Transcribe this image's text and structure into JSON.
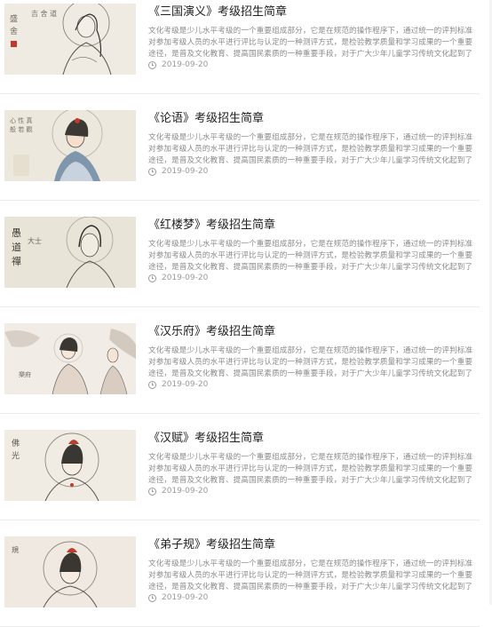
{
  "articles": [
    {
      "title": "《三国演义》考级招生简章",
      "excerpt": "文化考级是少儿水平考级的一个重要组成部分，它是在规范的操作程序下，通过统一的评判标准对参加考级人员的水平进行评比与认定的一种测评方式，是检验教学质量和学习成果的一个重要途径，是普及文化教育、提高国民素质的一种重要手段，对于广大少年儿童学习传统文化起到了积极的推动作用。",
      "date": "2019-09-20",
      "image_icon": "guanyin-painting-thumbnail"
    },
    {
      "title": "《论语》考级招生简章",
      "excerpt": "文化考级是少儿水平考级的一个重要组成部分，它是在规范的操作程序下，通过统一的评判标准对参加考级人员的水平进行评比与认定的一种测评方式，是检验教学质量和学习成果的一个重要途径，是普及文化教育、提高国民素质的一种重要手段，对于广大少年儿童学习传统文化起到了积极的推动作用。",
      "date": "2019-09-20",
      "image_icon": "guanyin-painting-thumbnail"
    },
    {
      "title": "《红楼梦》考级招生简章",
      "excerpt": "文化考级是少儿水平考级的一个重要组成部分，它是在规范的操作程序下，通过统一的评判标准对参加考级人员的水平进行评比与认定的一种测评方式，是检验教学质量和学习成果的一个重要途径，是普及文化教育、提高国民素质的一种重要手段，对于广大少年儿童学习传统文化起到了积极的推动作用。",
      "date": "2019-09-20",
      "image_icon": "guanyin-painting-thumbnail"
    },
    {
      "title": "《汉乐府》考级招生简章",
      "excerpt": "文化考级是少儿水平考级的一个重要组成部分，它是在规范的操作程序下，通过统一的评判标准对参加考级人员的水平进行评比与认定的一种测评方式，是检验教学质量和学习成果的一个重要途径，是普及文化教育、提高国民素质的一种重要手段，对于广大少年儿童学习传统文化起到了积极的推动作用。",
      "date": "2019-09-20",
      "image_icon": "guanyin-painting-thumbnail"
    },
    {
      "title": "《汉赋》考级招生简章",
      "excerpt": "文化考级是少儿水平考级的一个重要组成部分，它是在规范的操作程序下，通过统一的评判标准对参加考级人员的水平进行评比与认定的一种测评方式，是检验教学质量和学习成果的一个重要途径，是普及文化教育、提高国民素质的一种重要手段，对于广大少年儿童学习传统文化起到了积极的推动作用。",
      "date": "2019-09-20",
      "image_icon": "guanyin-painting-thumbnail"
    },
    {
      "title": "《弟子规》考级招生简章",
      "excerpt": "文化考级是少儿水平考级的一个重要组成部分，它是在规范的操作程序下，通过统一的评判标准对参加考级人员的水平进行评比与认定的一种测评方式，是检验教学质量和学习成果的一个重要途径，是普及文化教育、提高国民素质的一种重要手段，对于广大少年儿童学习传统文化起到了积极的推动作用。",
      "date": "2019-09-20",
      "image_icon": "guanyin-painting-thumbnail"
    }
  ],
  "colors": {
    "title": "#222222",
    "excerpt": "#8b8b8b",
    "meta": "#9a9a9a",
    "divider": "#ececec"
  }
}
